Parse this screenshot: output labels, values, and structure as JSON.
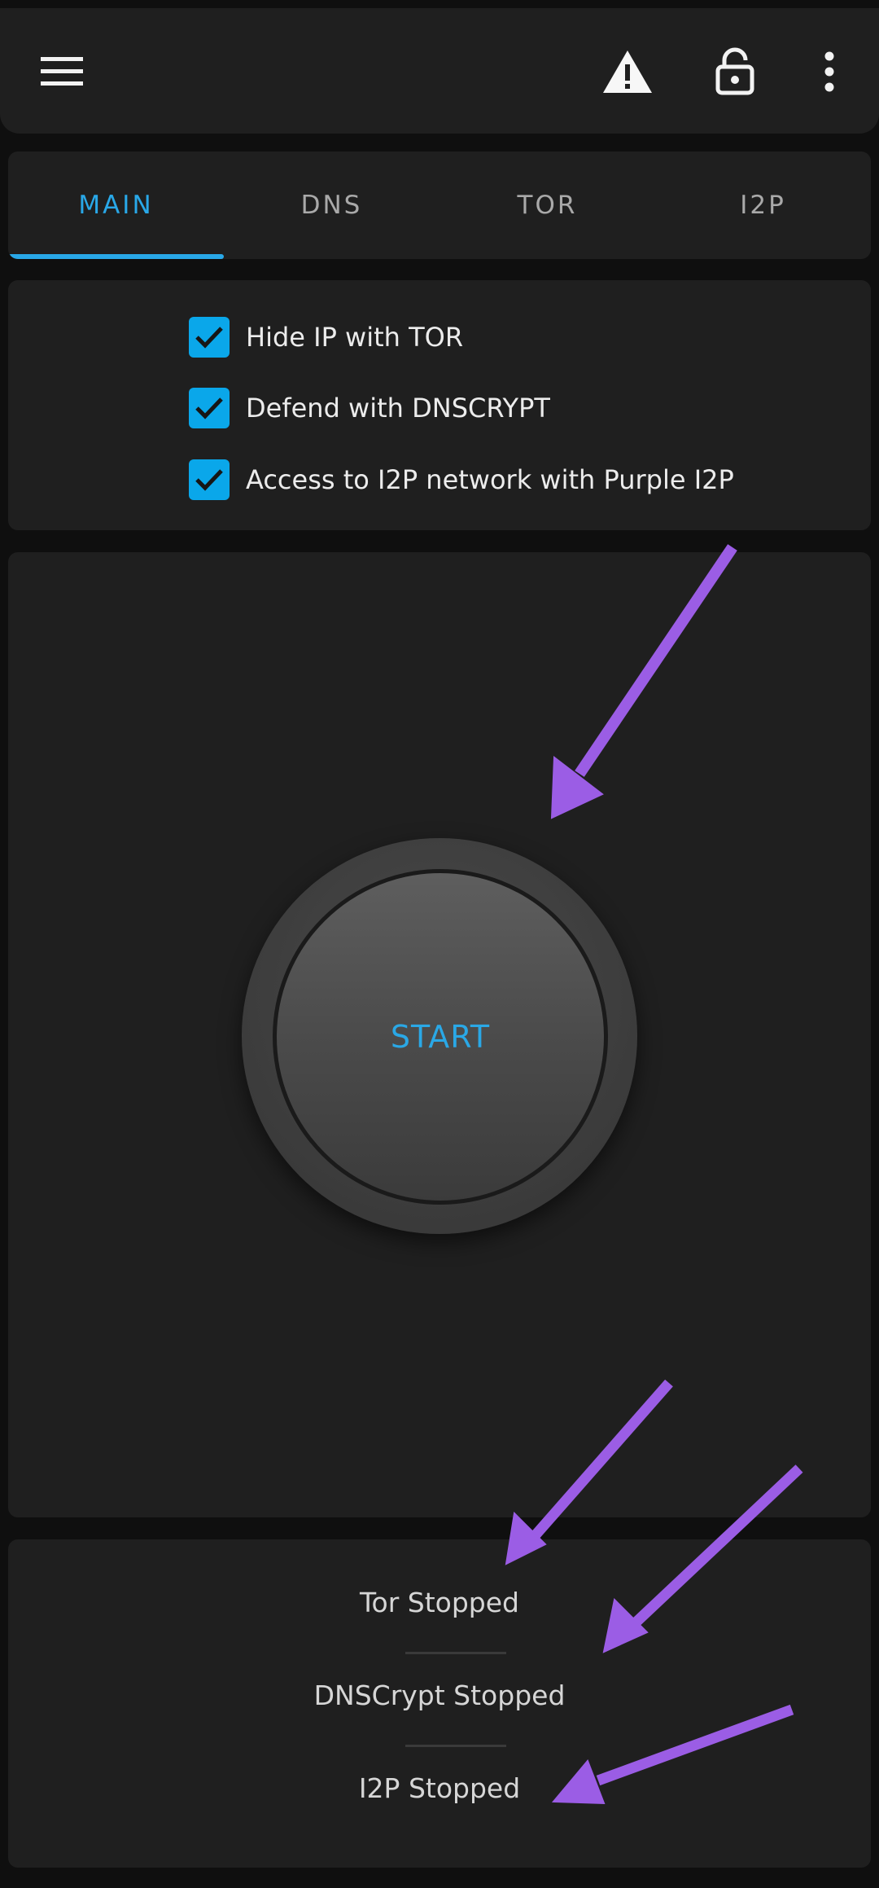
{
  "header": {
    "icons": [
      "menu-icon",
      "warning-icon",
      "lock-icon",
      "more-vert-icon"
    ]
  },
  "tabs": [
    {
      "label": "MAIN",
      "active": true
    },
    {
      "label": "DNS",
      "active": false
    },
    {
      "label": "TOR",
      "active": false
    },
    {
      "label": "I2P",
      "active": false
    }
  ],
  "options": [
    {
      "label": "Hide IP with TOR",
      "checked": true
    },
    {
      "label": "Defend with DNSCRYPT",
      "checked": true
    },
    {
      "label": "Access to I2P network with Purple I2P",
      "checked": true
    }
  ],
  "main": {
    "start_label": "START"
  },
  "status": {
    "tor": "Tor Stopped",
    "dnscrypt": "DNSCrypt Stopped",
    "i2p": "I2P Stopped"
  },
  "colors": {
    "accent": "#29a8e8",
    "checkbox": "#0aa7ea",
    "card_bg": "#1f1f1f",
    "page_bg": "#0f0f0f",
    "annotation": "#9b5de5"
  }
}
